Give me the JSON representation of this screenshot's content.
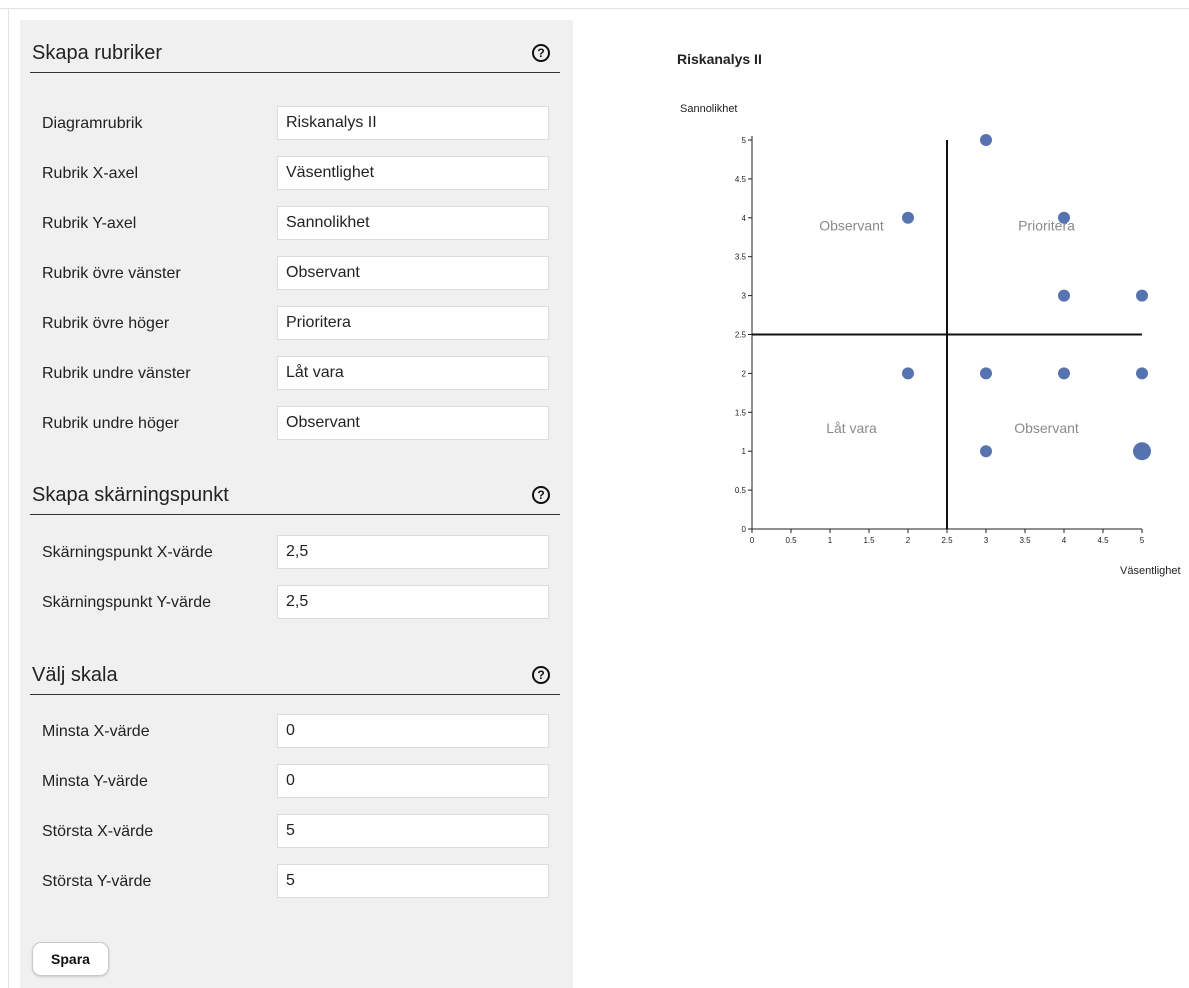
{
  "settings": {
    "headings": {
      "title": "Skapa rubriker",
      "fields": [
        {
          "label": "Diagramrubrik",
          "value": "Riskanalys II"
        },
        {
          "label": "Rubrik X-axel",
          "value": "Väsentlighet"
        },
        {
          "label": "Rubrik Y-axel",
          "value": "Sannolikhet"
        },
        {
          "label": "Rubrik övre vänster",
          "value": "Observant"
        },
        {
          "label": "Rubrik övre höger",
          "value": "Prioritera"
        },
        {
          "label": "Rubrik undre vänster",
          "value": "Låt vara"
        },
        {
          "label": "Rubrik undre höger",
          "value": "Observant"
        }
      ]
    },
    "intersection": {
      "title": "Skapa skärningspunkt",
      "fields": [
        {
          "label": "Skärningspunkt X-värde",
          "value": "2,5"
        },
        {
          "label": "Skärningspunkt Y-värde",
          "value": "2,5"
        }
      ]
    },
    "scale": {
      "title": "Välj skala",
      "fields": [
        {
          "label": "Minsta X-värde",
          "value": "0"
        },
        {
          "label": "Minsta Y-värde",
          "value": "0"
        },
        {
          "label": "Största X-värde",
          "value": "5"
        },
        {
          "label": "Största Y-värde",
          "value": "5"
        }
      ]
    },
    "help_glyph": "?",
    "save_label": "Spara"
  },
  "chart_data": {
    "type": "scatter",
    "title": "Riskanalys II",
    "xlabel": "Väsentlighet",
    "ylabel": "Sannolikhet",
    "xlim": [
      0,
      5
    ],
    "ylim": [
      0,
      5
    ],
    "xticks": [
      "0",
      "0.5",
      "1",
      "1.5",
      "2",
      "2.5",
      "3",
      "3.5",
      "4",
      "4.5",
      "5"
    ],
    "yticks": [
      "0",
      "0.5",
      "1",
      "1.5",
      "2",
      "2.5",
      "3",
      "3.5",
      "4",
      "4.5",
      "5"
    ],
    "crosshair": {
      "x": 2.5,
      "y": 2.5
    },
    "quadrant_labels": {
      "upper_left": "Observant",
      "upper_right": "Prioritera",
      "lower_left": "Låt vara",
      "lower_right": "Observant"
    },
    "points": [
      {
        "x": 3,
        "y": 5,
        "count": 1
      },
      {
        "x": 2,
        "y": 4,
        "count": 1
      },
      {
        "x": 4,
        "y": 4,
        "count": 1
      },
      {
        "x": 4,
        "y": 3,
        "count": 1
      },
      {
        "x": 5,
        "y": 3,
        "count": 1
      },
      {
        "x": 2,
        "y": 2,
        "count": 1
      },
      {
        "x": 3,
        "y": 2,
        "count": 1
      },
      {
        "x": 4,
        "y": 2,
        "count": 1
      },
      {
        "x": 5,
        "y": 2,
        "count": 1
      },
      {
        "x": 3,
        "y": 1,
        "count": 1
      },
      {
        "x": 5,
        "y": 1,
        "count": 2
      }
    ],
    "point_color": "#5673b0",
    "quadrant_label_color": "#8a8a8a"
  }
}
